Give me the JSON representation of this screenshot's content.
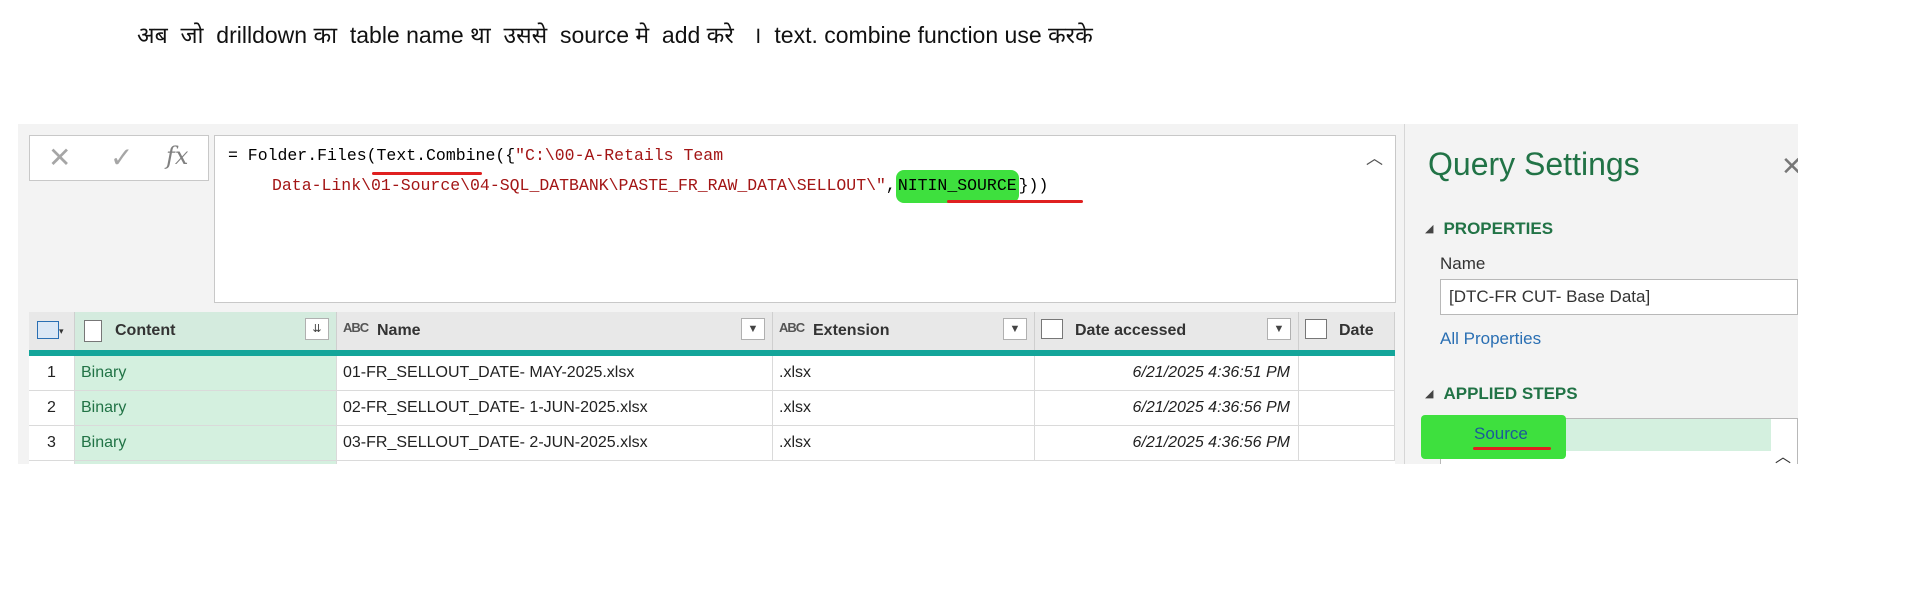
{
  "caption": "अब  जो  drilldown का  table name था  उससे  source मे  add करे   ।  text. combine function use करके",
  "formula_bar": {
    "cancel_icon": "✕",
    "commit_icon": "✓",
    "fx_icon": "fx",
    "line1_prefix": "= Folder.Files(Text.Combine({",
    "line1_string": "\"C:\\00-A-Retails Team",
    "line2_string": "Data-Link\\01-Source\\04-SQL_DATBANK\\PASTE_FR_RAW_DATA\\SELLOUT\\\"",
    "line2_comma": ",",
    "highlighted": "NITIN_SOURCE",
    "line2_suffix": "}))",
    "collapse_icon": "chevron-up-icon"
  },
  "grid": {
    "columns": [
      {
        "name": "Content",
        "type": ""
      },
      {
        "name": "Name",
        "type": "ABC"
      },
      {
        "name": "Extension",
        "type": "ABC"
      },
      {
        "name": "Date accessed",
        "type": "date"
      },
      {
        "name": "Date",
        "type": "date"
      }
    ],
    "rows": [
      {
        "num": "1",
        "content": "Binary",
        "name": "01-FR_SELLOUT_DATE- MAY-2025.xlsx",
        "extension": ".xlsx",
        "date_accessed": "6/21/2025 4:36:51 PM"
      },
      {
        "num": "2",
        "content": "Binary",
        "name": "02-FR_SELLOUT_DATE- 1-JUN-2025.xlsx",
        "extension": ".xlsx",
        "date_accessed": "6/21/2025 4:36:56 PM"
      },
      {
        "num": "3",
        "content": "Binary",
        "name": "03-FR_SELLOUT_DATE- 2-JUN-2025.xlsx",
        "extension": ".xlsx",
        "date_accessed": "6/21/2025 4:36:56 PM"
      }
    ]
  },
  "query_settings": {
    "title": "Query Settings",
    "properties_heading": "PROPERTIES",
    "name_label": "Name",
    "name_value": "[DTC-FR CUT- Base Data]",
    "all_properties": "All Properties",
    "applied_steps_heading": "APPLIED STEPS",
    "steps": [
      "Source"
    ]
  },
  "colors": {
    "accent_green": "#217346",
    "highlight_green": "#3ee03e",
    "underline_red": "#e02020",
    "teal": "#14a59a"
  }
}
